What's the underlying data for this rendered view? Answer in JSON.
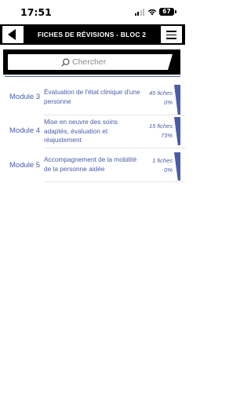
{
  "status": {
    "time": "17:51",
    "battery": "67"
  },
  "header": {
    "title": "FICHES DE RÉVISIONS - BLOC 2",
    "back_icon": "back-arrow-icon",
    "menu_icon": "hamburger-menu-icon"
  },
  "search": {
    "placeholder": "Chercher",
    "icon": "search-icon"
  },
  "modules": [
    {
      "label": "Module 3",
      "title": "Évaluation de l'état clinique d'une personne",
      "count": "45 fiches",
      "progress": "0%"
    },
    {
      "label": "Module 4",
      "title": "Mise en oeuvre des soins adaptés, évaluation et réajustement",
      "count": "15 fiches",
      "progress": "73%"
    },
    {
      "label": "Module 5",
      "title": "Accompagnement de la mobilité de la personne aidée",
      "count": "1 fiches",
      "progress": "0%"
    }
  ],
  "colors": {
    "accent": "#4a5ca8",
    "header_bg": "#000000"
  }
}
